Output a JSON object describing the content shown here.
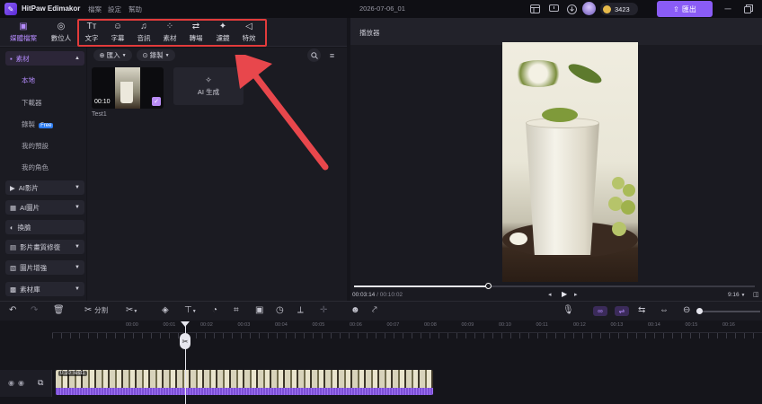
{
  "app": {
    "name": "HitPaw Edimakor",
    "project_title": "2026-07-06_01",
    "credits": "3423",
    "export_label": "匯出"
  },
  "menu": [
    {
      "label": "檔案"
    },
    {
      "label": "設定"
    },
    {
      "label": "幫助"
    }
  ],
  "toolbar": {
    "tabs": [
      {
        "label": "媒體檔案"
      },
      {
        "label": "數位人"
      }
    ],
    "tools": [
      {
        "label": "文字",
        "icon": "text-icon"
      },
      {
        "label": "字幕",
        "icon": "subtitle-icon"
      },
      {
        "label": "音訊",
        "icon": "music-icon"
      },
      {
        "label": "素材",
        "icon": "elements-icon"
      },
      {
        "label": "轉場",
        "icon": "transition-icon"
      },
      {
        "label": "濾鏡",
        "icon": "filter-icon"
      },
      {
        "label": "特效",
        "icon": "effects-icon"
      }
    ]
  },
  "sidebar": {
    "section_label": "素材",
    "sub_items": [
      {
        "label": "本地"
      },
      {
        "label": "下載器"
      },
      {
        "label": "錄製",
        "badge": "Free"
      },
      {
        "label": "我的預設"
      },
      {
        "label": "我的角色"
      }
    ],
    "categories": [
      {
        "label": "AI影片"
      },
      {
        "label": "AI圖片"
      },
      {
        "label": "換臉"
      },
      {
        "label": "影片畫質修復"
      },
      {
        "label": "圖片增強"
      },
      {
        "label": "素材庫"
      }
    ]
  },
  "media": {
    "import_label": "匯入",
    "record_label": "錄製",
    "clip": {
      "name": "Test1",
      "duration": "00:10"
    },
    "ai_generate_label": "AI 生成"
  },
  "preview": {
    "header": "播放器",
    "current_time": "00:03:14",
    "total_time": "00:10:02",
    "progress": 0.335,
    "aspect": "9:16"
  },
  "timeline_toolbar": {
    "split_label": "分割"
  },
  "timeline": {
    "ruler_labels": [
      "00:00",
      "00:01",
      "00:02",
      "00:03",
      "00:04",
      "00:05",
      "00:06",
      "00:07",
      "00:08",
      "00:09",
      "00:10",
      "00:11",
      "00:12",
      "00:13",
      "00:14",
      "00:15",
      "00:16",
      "00:17",
      "00:18",
      "00:19"
    ],
    "clip_label": "0:10 Test1"
  },
  "colors": {
    "accent": "#8b5cf6",
    "highlight_box": "#e23b3b",
    "export_button": "#8a5cf6"
  }
}
